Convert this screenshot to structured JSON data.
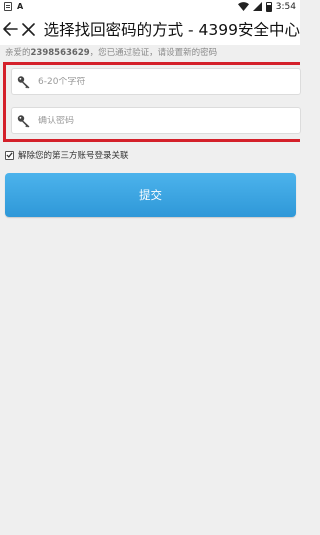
{
  "status_bar": {
    "time": "3:54",
    "left_icons": [
      "notification-icon",
      "a-icon"
    ],
    "right_icons": [
      "wifi-icon",
      "signal-icon",
      "battery-icon"
    ]
  },
  "app_bar": {
    "title": "选择找回密码的方式 - 4399安全中心",
    "back_icon": "arrow-left-icon",
    "close_icon": "close-icon"
  },
  "hint": {
    "prefix": "亲爱的",
    "account": "2398563629",
    "suffix": "，您已通过验证，请设置新的密码"
  },
  "form": {
    "new_password": {
      "value": "",
      "placeholder": "6-20个字符",
      "icon": "key-icon"
    },
    "confirm_password": {
      "value": "",
      "placeholder": "确认密码",
      "icon": "key-icon"
    },
    "highlight_color": "#d4202a"
  },
  "unlink": {
    "checked": true,
    "label": "解除您的第三方账号登录关联"
  },
  "submit": {
    "label": "提交",
    "color": "#3ba6e2"
  }
}
